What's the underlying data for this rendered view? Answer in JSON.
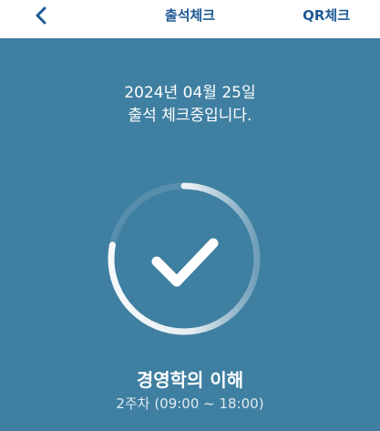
{
  "header": {
    "title": "출석체크",
    "qr_label": "QR체크",
    "back_icon": "chevron-left-icon"
  },
  "attendance": {
    "date": "2024년 04월 25일",
    "status": "출석 체크중입니다.",
    "progress_fraction": 0.78,
    "check_icon": "check-icon"
  },
  "course": {
    "title": "경영학의 이해",
    "session": "2주차 (09:00 ~ 18:00)"
  },
  "colors": {
    "header_text": "#1e5a94",
    "background": "#3f7fa1",
    "ring": "#ffffff",
    "text": "#ffffff"
  }
}
